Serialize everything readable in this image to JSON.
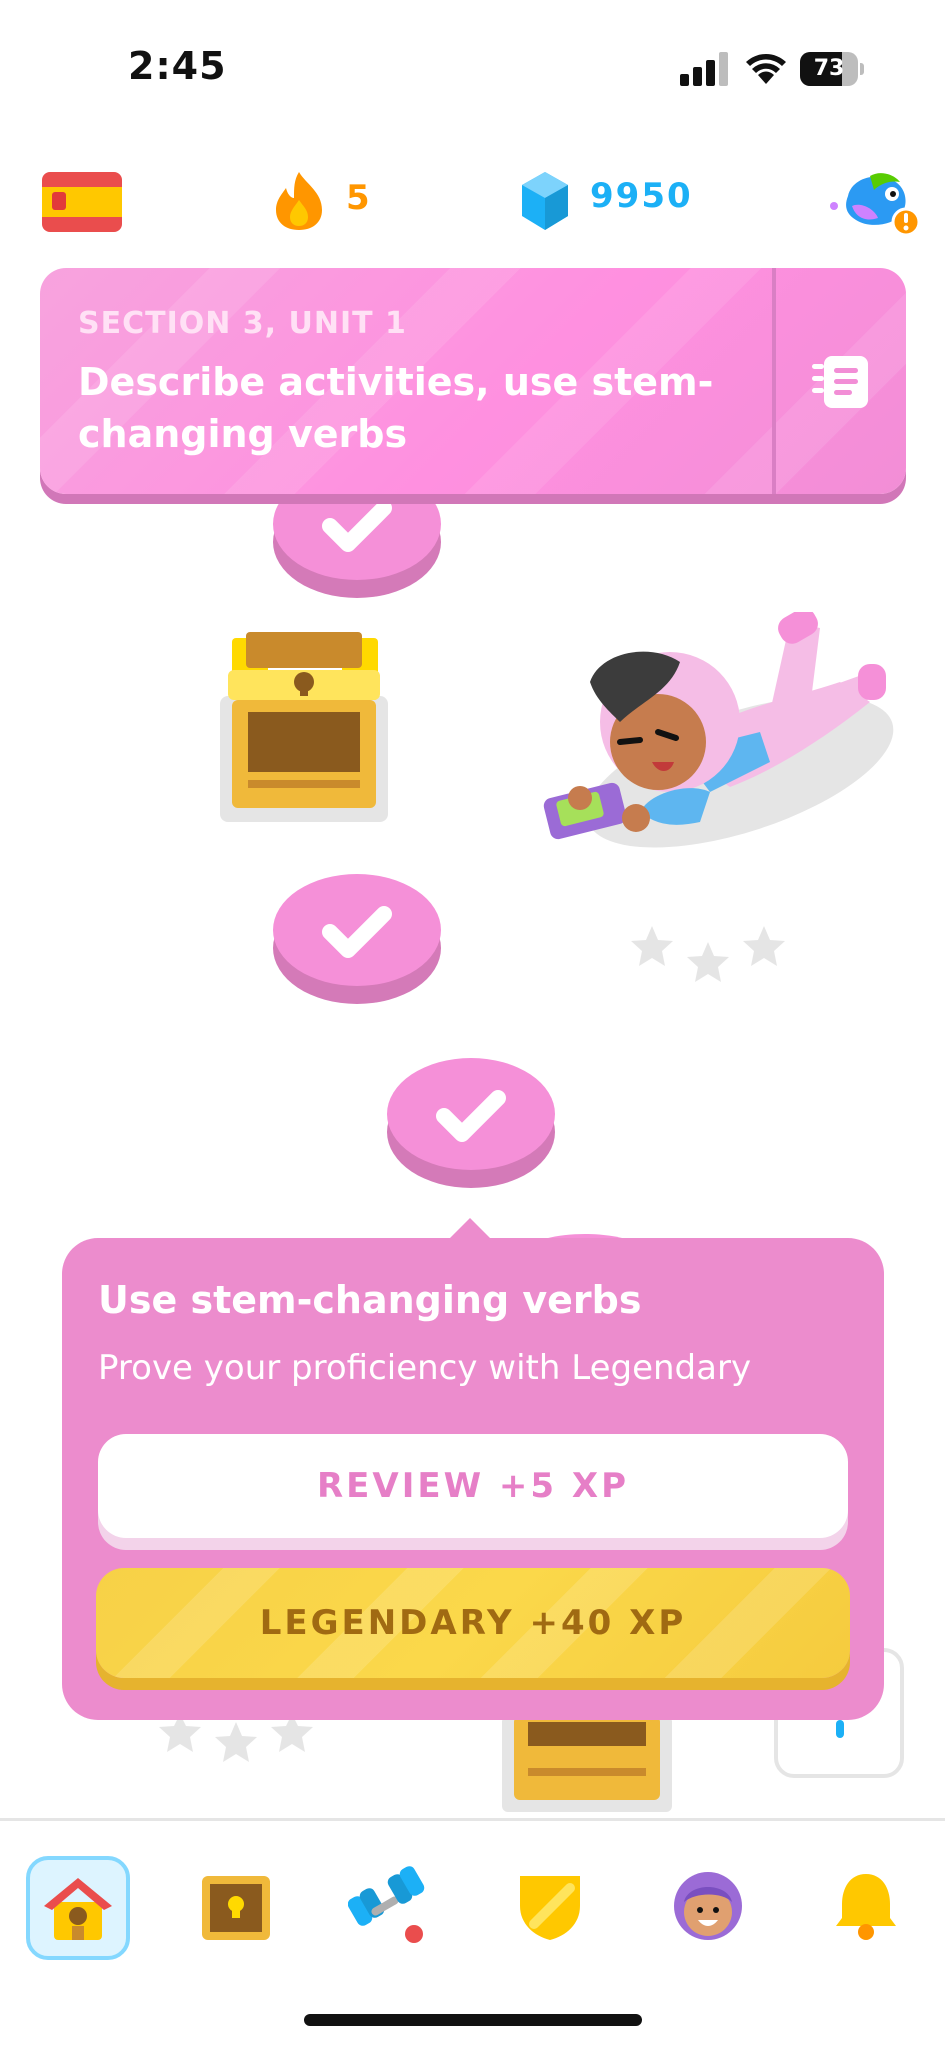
{
  "status_bar": {
    "time": "2:45",
    "battery": "73",
    "battery_level": 0.73
  },
  "top_bar": {
    "course_flag": "spain-flag",
    "streak": {
      "icon": "flame-icon",
      "count": "5"
    },
    "gems": {
      "icon": "gem-icon",
      "count": "9950"
    },
    "profile": {
      "icon": "avatar-alert-icon"
    }
  },
  "unit_banner": {
    "section": "SECTION 3, UNIT 1",
    "title": "Describe activities, use stem-changing verbs",
    "guidebook_icon": "guidebook-icon"
  },
  "path": {
    "nodes": [
      {
        "type": "lesson",
        "state": "completed",
        "icon": "check-icon"
      },
      {
        "type": "chest",
        "state": "opened",
        "icon": "chest-icon"
      },
      {
        "type": "lesson",
        "state": "completed",
        "icon": "check-icon"
      },
      {
        "type": "lesson",
        "state": "completed",
        "icon": "check-icon"
      },
      {
        "type": "lesson",
        "state": "hidden"
      },
      {
        "type": "chest",
        "state": "locked",
        "icon": "chest-icon"
      }
    ],
    "character": "duo-character-playing-game",
    "stars_icon": "stars-icon"
  },
  "popover": {
    "title": "Use stem-changing verbs",
    "description": "Prove your proficiency with Legendary",
    "review_label": "REVIEW +5 XP",
    "legendary_label": "LEGENDARY +40 XP"
  },
  "bottom_nav": [
    {
      "name": "learn",
      "icon": "home-icon",
      "active": true
    },
    {
      "name": "chest",
      "icon": "chest-icon",
      "active": false
    },
    {
      "name": "practice",
      "icon": "dumbbell-icon",
      "active": false
    },
    {
      "name": "leagues",
      "icon": "shield-icon",
      "active": false
    },
    {
      "name": "profile",
      "icon": "character-icon",
      "active": false
    },
    {
      "name": "notifications",
      "icon": "bell-icon",
      "active": false
    }
  ],
  "colors": {
    "unit": "#ff90e0",
    "unit_shadow": "#d177b8",
    "popover": "#ec8ccd",
    "legendary": "#f7d147",
    "streak": "#ff9600",
    "gem": "#1cb0f6"
  }
}
